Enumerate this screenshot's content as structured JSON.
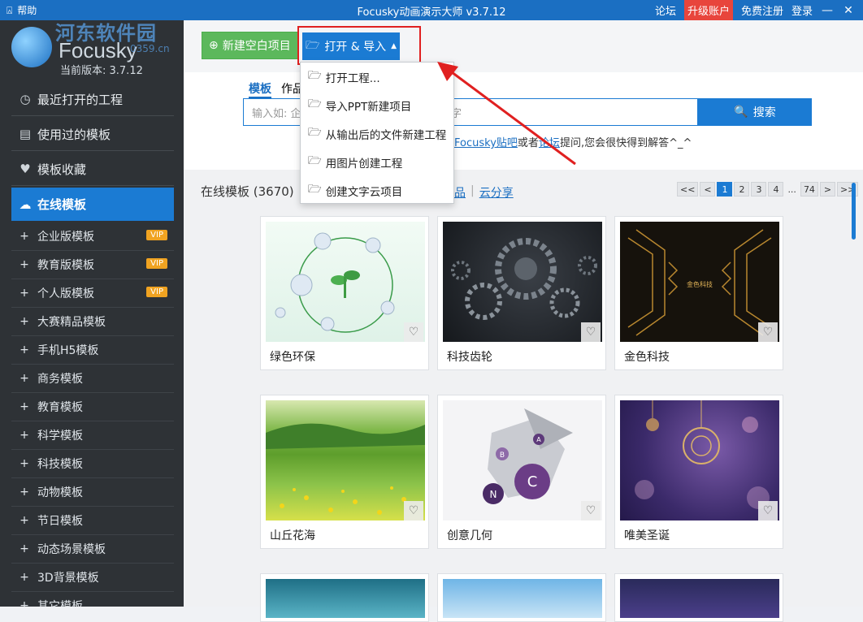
{
  "window": {
    "title": "Focusky动画演示大师 v3.7.12",
    "help_label": "帮助",
    "links": {
      "forum": "论坛",
      "upgrade": "升级账户",
      "register": "免费注册",
      "login": "登录"
    },
    "minimize": "—",
    "close": "✕"
  },
  "brand": {
    "watermark_text": "河东软件园",
    "watermark_url": "0359.cn",
    "product_name": "Focusky",
    "version_label": "当前版本: 3.7.12"
  },
  "sidebar": {
    "items": [
      {
        "label": "最近打开的工程",
        "icon": "clock-icon"
      },
      {
        "label": "使用过的模板",
        "icon": "list-icon"
      },
      {
        "label": "模板收藏",
        "icon": "heart-box-icon"
      },
      {
        "label": "在线模板",
        "icon": "cloud-icon",
        "active": true
      }
    ],
    "sub_items": [
      {
        "label": "企业版模板",
        "badge": "VIP"
      },
      {
        "label": "教育版模板",
        "badge": "VIP"
      },
      {
        "label": "个人版模板",
        "badge": "VIP"
      },
      {
        "label": "大赛精品模板"
      },
      {
        "label": "手机H5模板"
      },
      {
        "label": "商务模板"
      },
      {
        "label": "教育模板"
      },
      {
        "label": "科学模板"
      },
      {
        "label": "科技模板"
      },
      {
        "label": "动物模板"
      },
      {
        "label": "节日模板"
      },
      {
        "label": "动态场景模板"
      },
      {
        "label": "3D背景模板"
      },
      {
        "label": "其它模板"
      }
    ]
  },
  "toolbar": {
    "new_project_label": "新建空白项目",
    "open_import_label": "打开 & 导入"
  },
  "dropdown": {
    "items": [
      "打开工程...",
      "导入PPT新建项目",
      "从输出后的文件新建工程",
      "用图片创建工程",
      "创建文字云项目"
    ]
  },
  "search": {
    "tabs": [
      "模板",
      "作品"
    ],
    "placeholder": "输入如: 企",
    "placeholder_tail": "字",
    "button_label": "搜索",
    "hint_prefix": "在",
    "hint_link1": "Focusky贴吧",
    "hint_mid": "或者",
    "hint_link2": "论坛",
    "hint_suffix": "提问,您会很快得到解答^_^"
  },
  "gallery": {
    "title": "在线模板 (3670)",
    "share_links": [
      "品",
      "云分享"
    ],
    "pager": [
      "<<",
      "<",
      "1",
      "2",
      "3",
      "4",
      "...",
      "74",
      ">",
      ">>"
    ],
    "current_page": "1",
    "cards": [
      {
        "name": "绿色环保"
      },
      {
        "name": "科技齿轮"
      },
      {
        "name": "金色科技",
        "thumb_text": "金色科技"
      },
      {
        "name": "山丘花海"
      },
      {
        "name": "创意几何",
        "thumb_letters": [
          "A",
          "B",
          "C",
          "N"
        ]
      },
      {
        "name": "唯美圣诞"
      }
    ]
  },
  "colors": {
    "accent": "#1b7bd3",
    "sidebar_bg": "#2e3236",
    "green_button": "#5cb85c",
    "vip_badge": "#f0a321",
    "highlight_red": "#e02020"
  }
}
